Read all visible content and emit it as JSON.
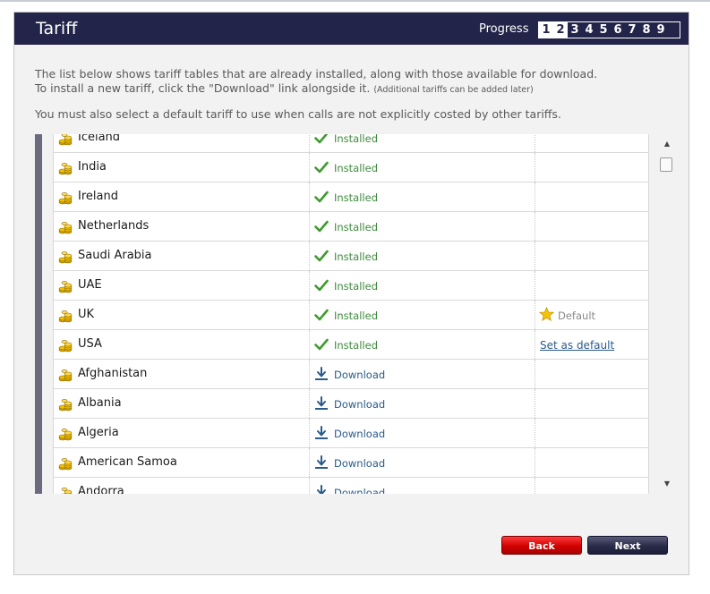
{
  "header": {
    "title": "Tariff",
    "progress_label": "Progress",
    "steps": [
      {
        "label": "1",
        "done": true
      },
      {
        "label": "2",
        "done": true
      },
      {
        "label": "3",
        "done": false
      },
      {
        "label": "4",
        "done": false
      },
      {
        "label": "5",
        "done": false
      },
      {
        "label": "6",
        "done": false
      },
      {
        "label": "7",
        "done": false
      },
      {
        "label": "8",
        "done": false
      },
      {
        "label": "9",
        "done": false
      }
    ]
  },
  "intro": {
    "line1": "The list below shows tariff tables that are already installed, along with those available for download.",
    "line2": "To install a new tariff, click the \"Download\" link alongside it.",
    "line2_note": "(Additional tariffs can be added later)",
    "line3": "You must also select a default tariff to use when calls are not explicitly costed by other tariffs."
  },
  "tariffs": [
    {
      "name": "Iceland",
      "status": "Installed",
      "status_type": "installed",
      "default_text": "",
      "default_type": "none"
    },
    {
      "name": "India",
      "status": "Installed",
      "status_type": "installed",
      "default_text": "",
      "default_type": "none"
    },
    {
      "name": "Ireland",
      "status": "Installed",
      "status_type": "installed",
      "default_text": "",
      "default_type": "none"
    },
    {
      "name": "Netherlands",
      "status": "Installed",
      "status_type": "installed",
      "default_text": "",
      "default_type": "none"
    },
    {
      "name": "Saudi Arabia",
      "status": "Installed",
      "status_type": "installed",
      "default_text": "",
      "default_type": "none"
    },
    {
      "name": "UAE",
      "status": "Installed",
      "status_type": "installed",
      "default_text": "",
      "default_type": "none"
    },
    {
      "name": "UK",
      "status": "Installed",
      "status_type": "installed",
      "default_text": "Default",
      "default_type": "default"
    },
    {
      "name": "USA",
      "status": "Installed",
      "status_type": "installed",
      "default_text": "Set as default",
      "default_type": "link"
    },
    {
      "name": "Afghanistan",
      "status": "Download",
      "status_type": "download",
      "default_text": "",
      "default_type": "none"
    },
    {
      "name": "Albania",
      "status": "Download",
      "status_type": "download",
      "default_text": "",
      "default_type": "none"
    },
    {
      "name": "Algeria",
      "status": "Download",
      "status_type": "download",
      "default_text": "",
      "default_type": "none"
    },
    {
      "name": "American Samoa",
      "status": "Download",
      "status_type": "download",
      "default_text": "",
      "default_type": "none"
    },
    {
      "name": "Andorra",
      "status": "Download",
      "status_type": "download",
      "default_text": "",
      "default_type": "none"
    }
  ],
  "buttons": {
    "back": "Back",
    "next": "Next"
  },
  "colors": {
    "header_bg": "#23244a",
    "installed": "#3f8b3f",
    "link": "#2a5a8a",
    "back_button": "#d10000",
    "next_button": "#2a2b48"
  },
  "icons": {
    "tariff": "coins-icon",
    "installed": "checkmark-icon",
    "download": "download-arrow-icon",
    "default": "star-icon"
  }
}
